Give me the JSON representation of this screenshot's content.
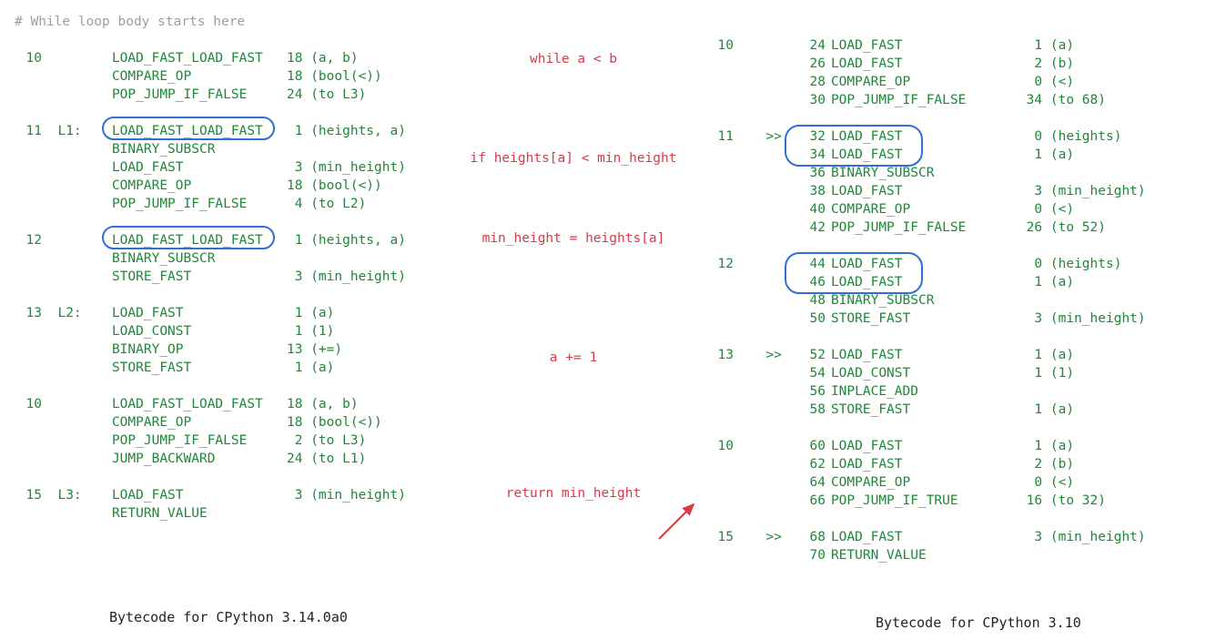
{
  "comment": "# While loop body starts here",
  "left": [
    {
      "line": "10",
      "label": "",
      "op": "LOAD_FAST_LOAD_FAST",
      "arg": "18 (a, b)"
    },
    {
      "line": "",
      "label": "",
      "op": "COMPARE_OP",
      "arg": "18 (bool(<))"
    },
    {
      "line": "",
      "label": "",
      "op": "POP_JUMP_IF_FALSE",
      "arg": "24 (to L3)"
    },
    null,
    {
      "line": "11",
      "label": "L1:",
      "op": "LOAD_FAST_LOAD_FAST",
      "arg": " 1 (heights, a)"
    },
    {
      "line": "",
      "label": "",
      "op": "BINARY_SUBSCR",
      "arg": ""
    },
    {
      "line": "",
      "label": "",
      "op": "LOAD_FAST",
      "arg": " 3 (min_height)"
    },
    {
      "line": "",
      "label": "",
      "op": "COMPARE_OP",
      "arg": "18 (bool(<))"
    },
    {
      "line": "",
      "label": "",
      "op": "POP_JUMP_IF_FALSE",
      "arg": " 4 (to L2)"
    },
    null,
    {
      "line": "12",
      "label": "",
      "op": "LOAD_FAST_LOAD_FAST",
      "arg": " 1 (heights, a)"
    },
    {
      "line": "",
      "label": "",
      "op": "BINARY_SUBSCR",
      "arg": ""
    },
    {
      "line": "",
      "label": "",
      "op": "STORE_FAST",
      "arg": " 3 (min_height)"
    },
    null,
    {
      "line": "13",
      "label": "L2:",
      "op": "LOAD_FAST",
      "arg": " 1 (a)"
    },
    {
      "line": "",
      "label": "",
      "op": "LOAD_CONST",
      "arg": " 1 (1)"
    },
    {
      "line": "",
      "label": "",
      "op": "BINARY_OP",
      "arg": "13 (+=)"
    },
    {
      "line": "",
      "label": "",
      "op": "STORE_FAST",
      "arg": " 1 (a)"
    },
    null,
    {
      "line": "10",
      "label": "",
      "op": "LOAD_FAST_LOAD_FAST",
      "arg": "18 (a, b)"
    },
    {
      "line": "",
      "label": "",
      "op": "COMPARE_OP",
      "arg": "18 (bool(<))"
    },
    {
      "line": "",
      "label": "",
      "op": "POP_JUMP_IF_FALSE",
      "arg": " 2 (to L3)"
    },
    {
      "line": "",
      "label": "",
      "op": "JUMP_BACKWARD",
      "arg": "24 (to L1)"
    },
    null,
    {
      "line": "15",
      "label": "L3:",
      "op": "LOAD_FAST",
      "arg": " 3 (min_height)"
    },
    {
      "line": "",
      "label": "",
      "op": "RETURN_VALUE",
      "arg": ""
    }
  ],
  "mid": [
    {
      "txt": "while a < b",
      "cls": "r"
    },
    {
      "txt": "if heights[a] < min_height",
      "cls": "r"
    },
    {
      "txt": "min_height = heights[a]",
      "cls": "r"
    },
    {
      "txt": "a += 1",
      "cls": "r"
    },
    {
      "txt": "return min_height",
      "cls": "r"
    }
  ],
  "right": [
    {
      "line": "10",
      "mark": "",
      "off": "24",
      "op": "LOAD_FAST",
      "argn": "1",
      "argt": "(a)"
    },
    {
      "line": "",
      "mark": "",
      "off": "26",
      "op": "LOAD_FAST",
      "argn": "2",
      "argt": "(b)"
    },
    {
      "line": "",
      "mark": "",
      "off": "28",
      "op": "COMPARE_OP",
      "argn": "0",
      "argt": "(<)"
    },
    {
      "line": "",
      "mark": "",
      "off": "30",
      "op": "POP_JUMP_IF_FALSE",
      "argn": "34",
      "argt": "(to 68)"
    },
    null,
    {
      "line": "11",
      "mark": ">>",
      "off": "32",
      "op": "LOAD_FAST",
      "argn": "0",
      "argt": "(heights)"
    },
    {
      "line": "",
      "mark": "",
      "off": "34",
      "op": "LOAD_FAST",
      "argn": "1",
      "argt": "(a)"
    },
    {
      "line": "",
      "mark": "",
      "off": "36",
      "op": "BINARY_SUBSCR",
      "argn": "",
      "argt": ""
    },
    {
      "line": "",
      "mark": "",
      "off": "38",
      "op": "LOAD_FAST",
      "argn": "3",
      "argt": "(min_height)"
    },
    {
      "line": "",
      "mark": "",
      "off": "40",
      "op": "COMPARE_OP",
      "argn": "0",
      "argt": "(<)"
    },
    {
      "line": "",
      "mark": "",
      "off": "42",
      "op": "POP_JUMP_IF_FALSE",
      "argn": "26",
      "argt": "(to 52)"
    },
    null,
    {
      "line": "12",
      "mark": "",
      "off": "44",
      "op": "LOAD_FAST",
      "argn": "0",
      "argt": "(heights)"
    },
    {
      "line": "",
      "mark": "",
      "off": "46",
      "op": "LOAD_FAST",
      "argn": "1",
      "argt": "(a)"
    },
    {
      "line": "",
      "mark": "",
      "off": "48",
      "op": "BINARY_SUBSCR",
      "argn": "",
      "argt": ""
    },
    {
      "line": "",
      "mark": "",
      "off": "50",
      "op": "STORE_FAST",
      "argn": "3",
      "argt": "(min_height)"
    },
    null,
    {
      "line": "13",
      "mark": ">>",
      "off": "52",
      "op": "LOAD_FAST",
      "argn": "1",
      "argt": "(a)"
    },
    {
      "line": "",
      "mark": "",
      "off": "54",
      "op": "LOAD_CONST",
      "argn": "1",
      "argt": "(1)"
    },
    {
      "line": "",
      "mark": "",
      "off": "56",
      "op": "INPLACE_ADD",
      "argn": "",
      "argt": ""
    },
    {
      "line": "",
      "mark": "",
      "off": "58",
      "op": "STORE_FAST",
      "argn": "1",
      "argt": "(a)"
    },
    null,
    {
      "line": "10",
      "mark": "",
      "off": "60",
      "op": "LOAD_FAST",
      "argn": "1",
      "argt": "(a)"
    },
    {
      "line": "",
      "mark": "",
      "off": "62",
      "op": "LOAD_FAST",
      "argn": "2",
      "argt": "(b)"
    },
    {
      "line": "",
      "mark": "",
      "off": "64",
      "op": "COMPARE_OP",
      "argn": "0",
      "argt": "(<)"
    },
    {
      "line": "",
      "mark": "",
      "off": "66",
      "op": "POP_JUMP_IF_TRUE",
      "argn": "16",
      "argt": "(to 32)"
    },
    null,
    {
      "line": "15",
      "mark": ">>",
      "off": "68",
      "op": "LOAD_FAST",
      "argn": "3",
      "argt": "(min_height)"
    },
    {
      "line": "",
      "mark": "",
      "off": "70",
      "op": "RETURN_VALUE",
      "argn": "",
      "argt": ""
    }
  ],
  "captions": {
    "left": "Bytecode for CPython 3.14.0a0",
    "right": "Bytecode for CPython 3.10"
  }
}
